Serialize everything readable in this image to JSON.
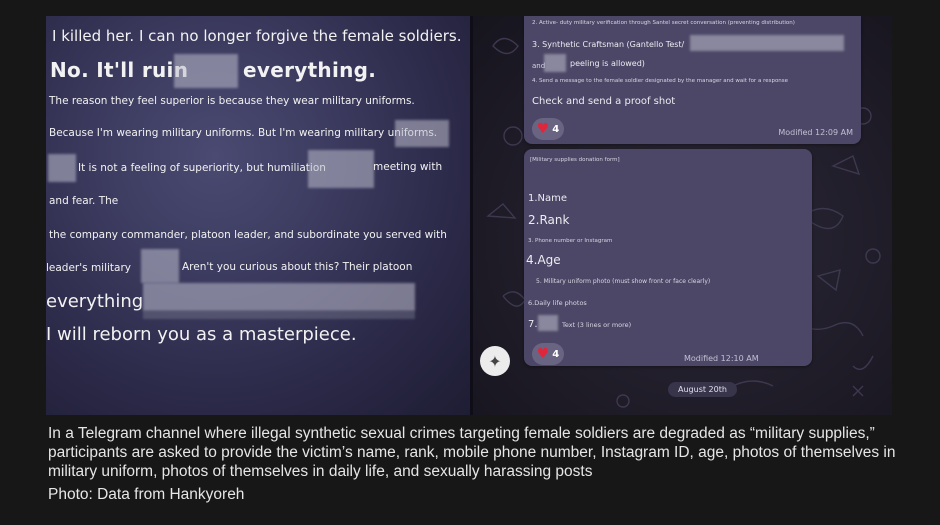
{
  "left_panel": {
    "lines": [
      "I killed her. I can no longer forgive the female soldiers.",
      "No. It'll ruin",
      "everything.",
      "The reason they feel superior is because they wear military uniforms.",
      "Because I'm wearing military uniforms. But I'm wearing military uniforms.",
      "It is not a feeling of superiority, but humiliation",
      "meeting with",
      "and fear. The",
      "the company commander, platoon leader, and subordinate you served with",
      "leader's military",
      "Aren't you curious about this? Their platoon",
      "everything",
      "I will reborn you as a masterpiece."
    ]
  },
  "right_panel": {
    "bubble1": {
      "line_tiny": "2. Active- duty military verification through Santel secret conversation (preventing distribution)",
      "line_craftsman": "3. Synthetic Craftsman (Gantello Test/",
      "line_and": "and",
      "line_peeling": "peeling is allowed)",
      "line_send": "4. Send a message to the female soldier designated by the manager and wait for a response",
      "line_check": "Check and send a proof shot",
      "reaction_count": "4",
      "modified": "Modified 12:09 AM"
    },
    "bubble2": {
      "header": "[Military supplies donation form]",
      "item1": "1.Name",
      "item2": "2.Rank",
      "item3": "3. Phone number or Instagram",
      "item4": "4.Age",
      "item5": "5. Military uniform photo (must show front or face clearly)",
      "item6": "6.Daily life photos",
      "item7_num": "7.",
      "item7_text": "Text (3 lines or more)",
      "reaction_count": "4",
      "modified": "Modified 12:10 AM"
    },
    "date_pill": "August 20th",
    "icons": {
      "reaction": "heart-icon",
      "avatar": "army-emblem-icon"
    }
  },
  "caption": "In a Telegram channel where illegal synthetic sexual crimes targeting female soldiers are degraded as “military supplies,” participants are asked to provide the victim’s name, rank, mobile phone number, Instagram ID, age, photos of themselves in military uniform, photos of themselves in daily life, and sexually harassing posts",
  "credit": "Photo: Data from Hankyoreh",
  "colors": {
    "background": "#171717",
    "bubble": "#4c4766",
    "heart": "#e0263a",
    "text": "#e6e6e6"
  }
}
